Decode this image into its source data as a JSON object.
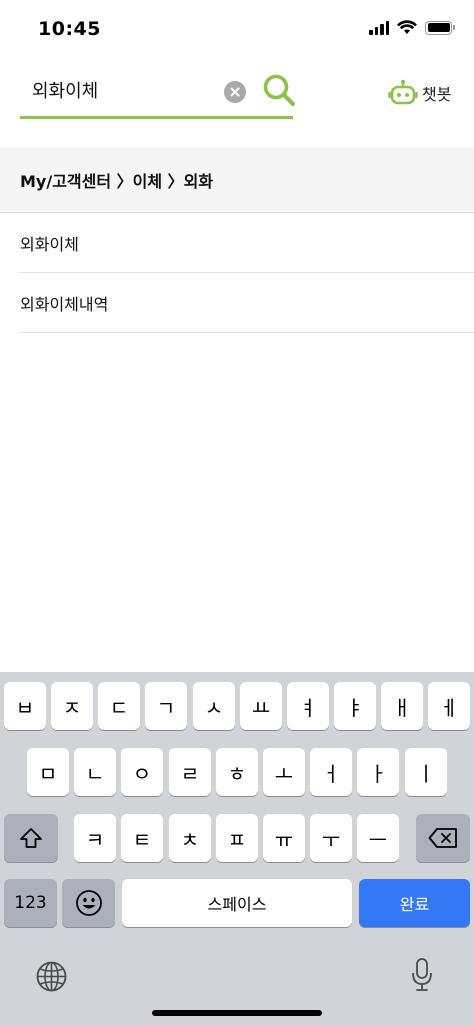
{
  "status_bar": {
    "time": "10:45"
  },
  "search": {
    "value": "외화이체",
    "placeholder": ""
  },
  "chatbot": {
    "label": "챗봇"
  },
  "breadcrumb": {
    "text": "My/고객센터 〉이체 〉외화"
  },
  "results": [
    {
      "label": "외화이체"
    },
    {
      "label": "외화이체내역"
    }
  ],
  "keyboard": {
    "row1": [
      "ㅂ",
      "ㅈ",
      "ㄷ",
      "ㄱ",
      "ㅅ",
      "ㅛ",
      "ㅕ",
      "ㅑ",
      "ㅐ",
      "ㅔ"
    ],
    "row2": [
      "ㅁ",
      "ㄴ",
      "ㅇ",
      "ㄹ",
      "ㅎ",
      "ㅗ",
      "ㅓ",
      "ㅏ",
      "ㅣ"
    ],
    "row3": [
      "ㅋ",
      "ㅌ",
      "ㅊ",
      "ㅍ",
      "ㅠ",
      "ㅜ",
      "ㅡ"
    ],
    "numbers_label": "123",
    "space_label": "스페이스",
    "done_label": "완료"
  },
  "colors": {
    "accent": "#8bc34a",
    "keyboard_bg": "#d1d3d9",
    "done_key": "#3478f6"
  },
  "icons": [
    "signal-icon",
    "wifi-icon",
    "battery-icon",
    "clear-icon",
    "search-icon",
    "chatbot-icon",
    "shift-icon",
    "backspace-icon",
    "emoji-icon",
    "globe-icon",
    "microphone-icon"
  ]
}
